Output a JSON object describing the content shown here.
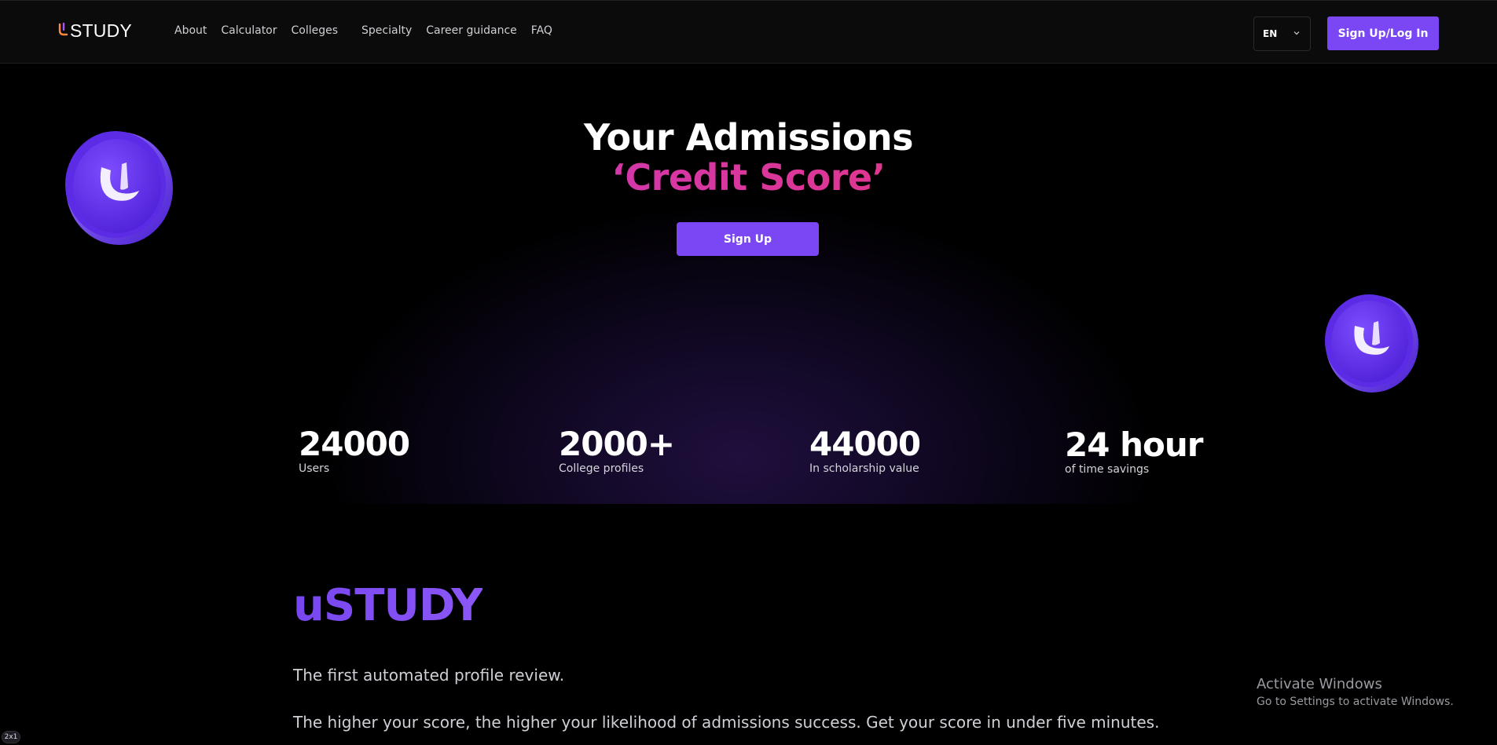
{
  "header": {
    "logo_text": "STUDY",
    "nav": [
      {
        "label": "About"
      },
      {
        "label": "Calculator"
      },
      {
        "label": "Colleges"
      },
      {
        "label": "Specialty"
      },
      {
        "label": "Career guidance"
      },
      {
        "label": "FAQ"
      }
    ],
    "language": "EN",
    "auth_label": "Sign Up/Log In"
  },
  "hero": {
    "title_line1": "Your Admissions",
    "title_line2": "‘Credit Score’",
    "signup_label": "Sign Up",
    "stats": [
      {
        "value": "24000",
        "label": "Users"
      },
      {
        "value": "2000+",
        "label": "College profiles"
      },
      {
        "value": "44000",
        "label": "In scholarship value"
      },
      {
        "value": "24 hour",
        "label": "of time savings"
      }
    ]
  },
  "about": {
    "title": "uSTUDY",
    "paragraph1": "The first automated profile review.",
    "paragraph2": "The higher your score, the higher your likelihood of admissions success. Get your score in under five minutes."
  },
  "overlay": {
    "activate_title": "Activate Windows",
    "activate_sub": "Go to Settings to activate Windows.",
    "corner_badge": "2x1"
  },
  "colors": {
    "accent": "#7b47f5",
    "pink_gradient_start": "#b63ae0",
    "pink_gradient_end": "#ee3a7c",
    "background": "#000000"
  }
}
